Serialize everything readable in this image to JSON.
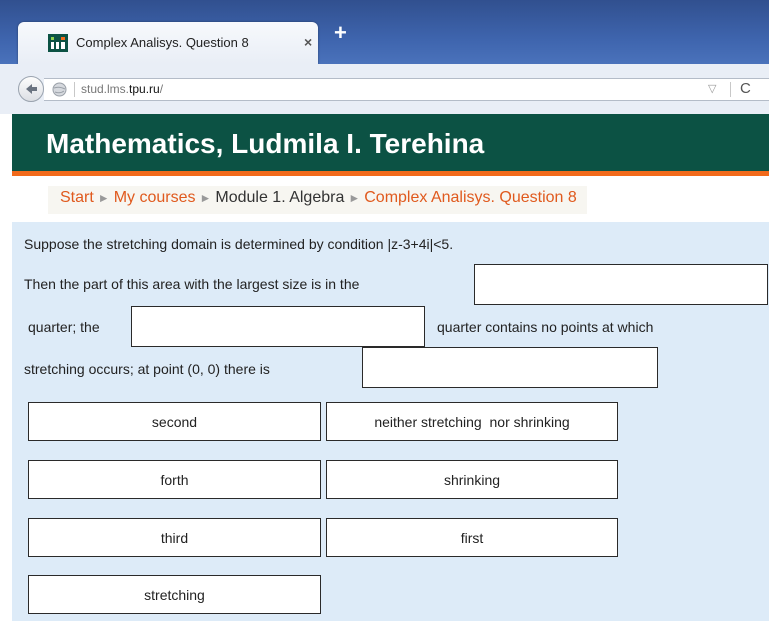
{
  "browser": {
    "tab_title": "Complex Analisys. Question 8",
    "tab_close": "×",
    "new_tab": "+",
    "url_prefix": "stud.lms.",
    "url_domain": "tpu.ru",
    "url_suffix": "/"
  },
  "header": {
    "title": "Mathematics, Ludmila I. Terehina",
    "accent_color": "#0c5244",
    "stripe_color": "#f26a1b"
  },
  "breadcrumb": {
    "items": [
      "Start",
      "My courses",
      "Module 1. Algebra",
      "Complex Analisys. Question 8"
    ],
    "separator": "►"
  },
  "question": {
    "line1": "Suppose the stretching domain is determined by condition |z-3+4i|<5.",
    "line2": "Then the part of this area with the largest size is in the",
    "line3a": "quarter; the",
    "line3b": "quarter contains no points at which",
    "line4": "stretching occurs; at point (0, 0) there is"
  },
  "choices": [
    "second",
    "neither stretching  nor shrinking",
    "forth",
    "shrinking",
    "third",
    "first",
    "stretching"
  ]
}
